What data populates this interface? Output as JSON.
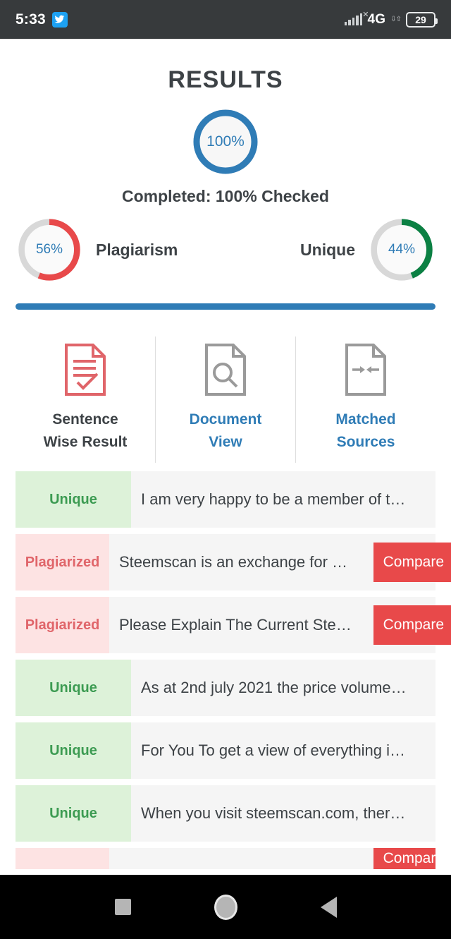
{
  "status_bar": {
    "time": "5:33",
    "app_badge_icon": "twitter-icon",
    "network": "4G",
    "battery_percent": "29"
  },
  "header": {
    "title": "RESULTS"
  },
  "overall": {
    "percent_label": "100%",
    "percent_value": 100,
    "completed_text": "Completed: 100% Checked",
    "ring_color": "#2f7cb6",
    "progress_bar_color": "#2f7cb6"
  },
  "stats": [
    {
      "name": "plagiarism",
      "percent_label": "56%",
      "percent_value": 56,
      "label": "Plagiarism",
      "color": "#e8494a",
      "label_side": "right"
    },
    {
      "name": "unique",
      "percent_label": "44%",
      "percent_value": 44,
      "label": "Unique",
      "color": "#0b8043",
      "label_side": "left"
    }
  ],
  "tabs": [
    {
      "label": "Sentence\nWise Result",
      "line1": "Sentence",
      "line2": "Wise Result",
      "icon": "document-check-icon",
      "active": true,
      "color": "#e0656a"
    },
    {
      "label": "Document\nView",
      "line1": "Document",
      "line2": "View",
      "icon": "document-search-icon",
      "active": false,
      "color": "#9a9a9a"
    },
    {
      "label": "Matched\nSources",
      "line1": "Matched",
      "line2": "Sources",
      "icon": "document-arrows-icon",
      "active": false,
      "color": "#9a9a9a"
    }
  ],
  "results": {
    "compare_label": "Compare",
    "rows": [
      {
        "status": "Unique",
        "type": "unique",
        "text": "I am very happy to be a member of t…",
        "has_compare": false
      },
      {
        "status": "Plagiarized",
        "type": "plag",
        "text": "Steemscan is an exchange for …",
        "has_compare": true
      },
      {
        "status": "Plagiarized",
        "type": "plag",
        "text": "Please Explain The Current Ste…",
        "has_compare": true
      },
      {
        "status": "Unique",
        "type": "unique",
        "text": "As at 2nd july 2021 the price volume…",
        "has_compare": false
      },
      {
        "status": "Unique",
        "type": "unique",
        "text": "For You To get a view of everything i…",
        "has_compare": false
      },
      {
        "status": "Unique",
        "type": "unique",
        "text": "When you visit steemscan.com, ther…",
        "has_compare": false
      },
      {
        "status": "",
        "type": "plag",
        "text": "",
        "has_compare": true
      }
    ]
  },
  "nav_bar": {
    "recents": "recents-square-icon",
    "home": "home-circle-icon",
    "back": "back-triangle-icon"
  }
}
